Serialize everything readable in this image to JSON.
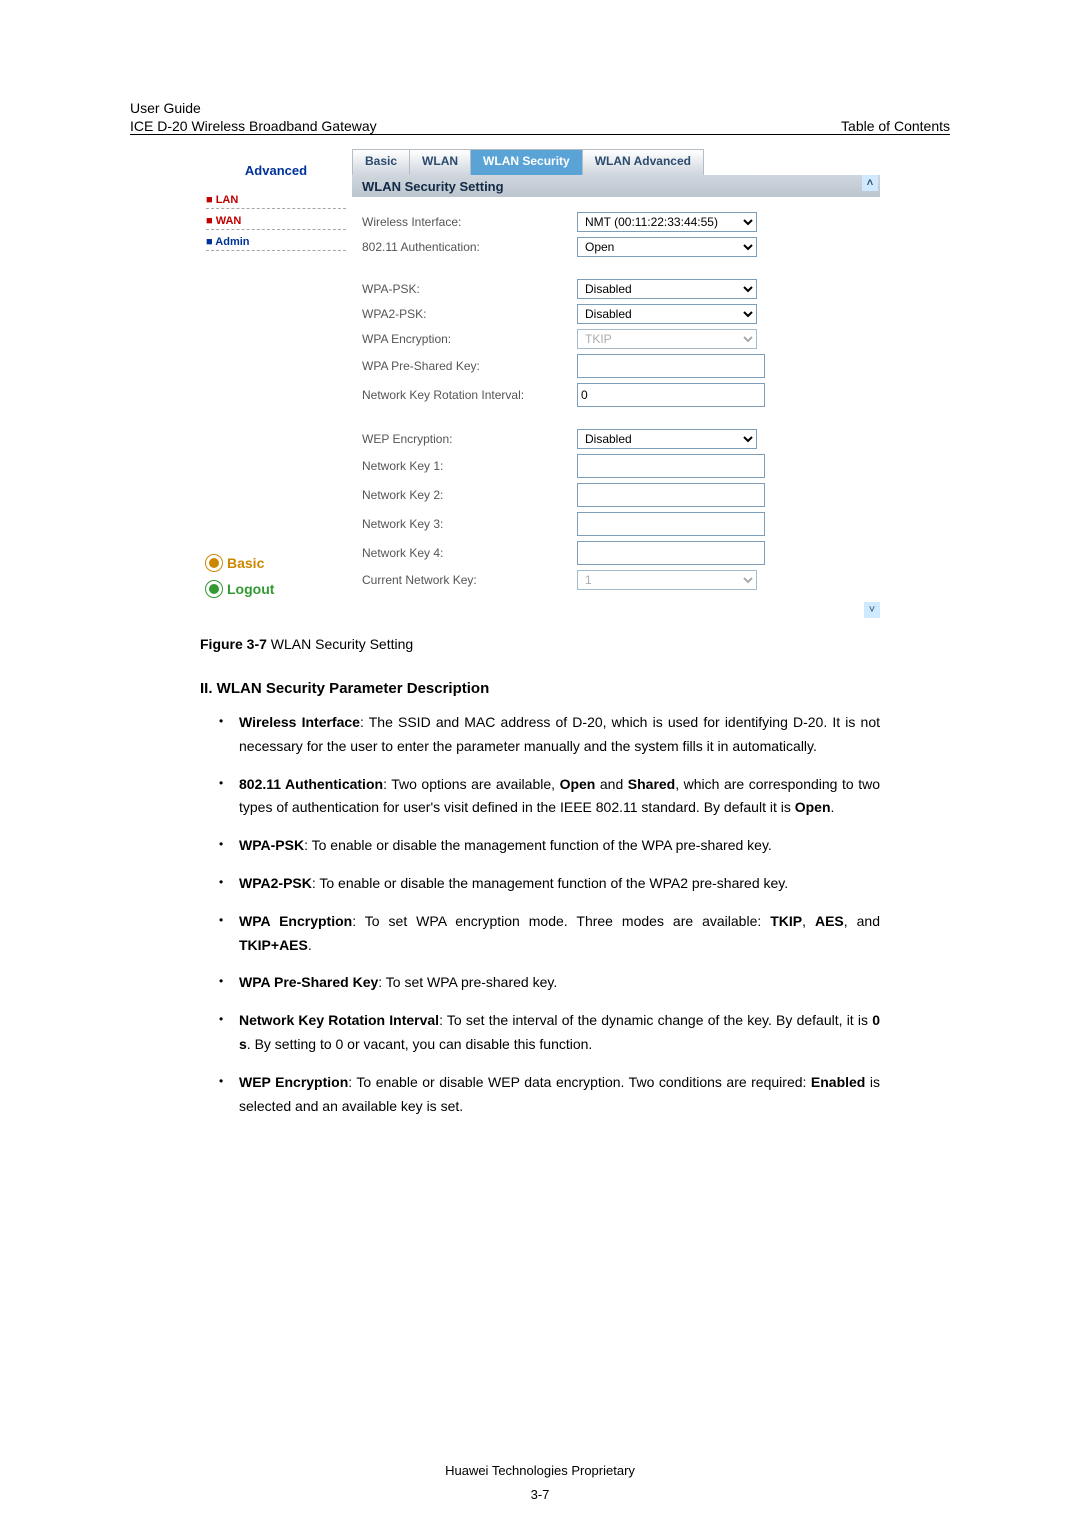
{
  "header": {
    "guide": "User Guide",
    "product": "ICE D-20 Wireless Broadband Gateway",
    "right": "Table of Contents"
  },
  "screenshot": {
    "adv_title": "Advanced",
    "nav": {
      "lan": "LAN",
      "wan": "WAN",
      "admin": "Admin"
    },
    "basic": "Basic",
    "logout": "Logout",
    "tabs": {
      "basic": "Basic",
      "wlan": "WLAN",
      "sec": "WLAN Security",
      "adv": "WLAN Advanced"
    },
    "panel_title": "WLAN Security Setting",
    "rows": {
      "wifi_iface_lbl": "Wireless Interface:",
      "wifi_iface_val": "NMT (00:11:22:33:44:55)",
      "auth_lbl": "802.11 Authentication:",
      "auth_val": "Open",
      "wpapsk_lbl": "WPA-PSK:",
      "wpapsk_val": "Disabled",
      "wpa2psk_lbl": "WPA2-PSK:",
      "wpa2psk_val": "Disabled",
      "wpaenc_lbl": "WPA Encryption:",
      "wpaenc_val": "TKIP",
      "wpapre_lbl": "WPA Pre-Shared Key:",
      "wpapre_val": "",
      "rot_lbl": "Network Key Rotation Interval:",
      "rot_val": "0",
      "wepenc_lbl": "WEP Encryption:",
      "wepenc_val": "Disabled",
      "nk1_lbl": "Network Key 1:",
      "nk1_val": "",
      "nk2_lbl": "Network Key 2:",
      "nk2_val": "",
      "nk3_lbl": "Network Key 3:",
      "nk3_val": "",
      "nk4_lbl": "Network Key 4:",
      "nk4_val": "",
      "cur_lbl": "Current Network Key:",
      "cur_val": "1"
    }
  },
  "caption": {
    "bold": "Figure 3-7 ",
    "rest": "WLAN Security Setting"
  },
  "section_title": "II. WLAN Security Parameter Description",
  "bullets": {
    "b1a": "Wireless Interface",
    "b1b": ": The SSID and MAC address of D-20, which is used for identifying D-20. It is not necessary for the user to enter the parameter manually and the system fills it in automatically.",
    "b2a": "802.11 Authentication",
    "b2b": ": Two options are available, ",
    "b2c": "Open",
    "b2d": " and ",
    "b2e": "Shared",
    "b2f": ", which are corresponding to two types of authentication for user's visit defined in the IEEE 802.11 standard. By default it is ",
    "b2g": "Open",
    "b2h": ".",
    "b3a": "WPA-PSK",
    "b3b": ": To enable or disable the management function of the WPA pre-shared key.",
    "b4a": "WPA2-PSK",
    "b4b": ": To enable or disable the management function of the WPA2 pre-shared key.",
    "b5a": "WPA Encryption",
    "b5b": ": To set WPA encryption mode. Three modes are available: ",
    "b5c": "TKIP",
    "b5d": ", ",
    "b5e": "AES",
    "b5f": ", and ",
    "b5g": "TKIP+AES",
    "b5h": ".",
    "b6a": "WPA Pre-Shared Key",
    "b6b": ": To set WPA pre-shared key.",
    "b7a": "Network Key Rotation Interval",
    "b7b": ": To set the interval of the dynamic change of the key. By default, it is ",
    "b7c": "0 s",
    "b7d": ". By setting to 0 or vacant, you can disable this function.",
    "b8a": "WEP Encryption",
    "b8b": ": To enable or disable WEP data encryption. Two conditions are required: ",
    "b8c": "Enabled",
    "b8d": " is selected and an available key is set."
  },
  "footer": "Huawei Technologies Proprietary",
  "pagenum": "3-7"
}
